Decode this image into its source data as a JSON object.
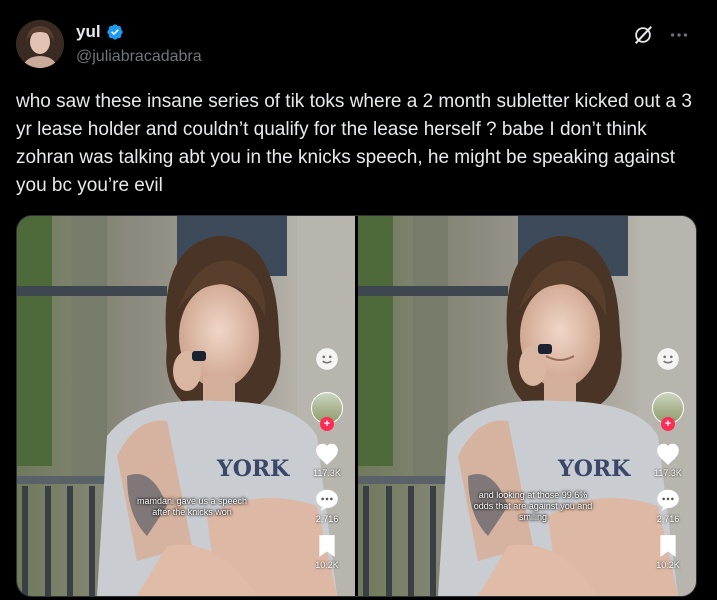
{
  "author": {
    "display_name": "yul",
    "handle": "@juliabracadabra",
    "verified": true
  },
  "actions": {
    "grok_icon": "grok-icon",
    "more_icon": "more-icon"
  },
  "tweet": {
    "text": "who saw these insane series of tik toks where a 2 month subletter kicked out a 3 yr lease holder and couldn’t qualify for the lease herself ? babe I don’t think zohran was talking abt you in the knicks speech, he might be speaking against you bc you’re evil"
  },
  "media": [
    {
      "caption": "mamdani gave us a speech after the knicks won",
      "likes": "117.3K",
      "comments": "2,716",
      "saves": "10.2K"
    },
    {
      "caption": "and looking at those 99.6% odds that are against you and smiling",
      "likes": "117.3K",
      "comments": "2,716",
      "saves": "10.2K"
    }
  ],
  "colors": {
    "background": "#000000",
    "text": "#e7e9ea",
    "muted": "#71767b",
    "verified_blue": "#1d9bf0",
    "tiktok_red": "#fe2c55"
  }
}
